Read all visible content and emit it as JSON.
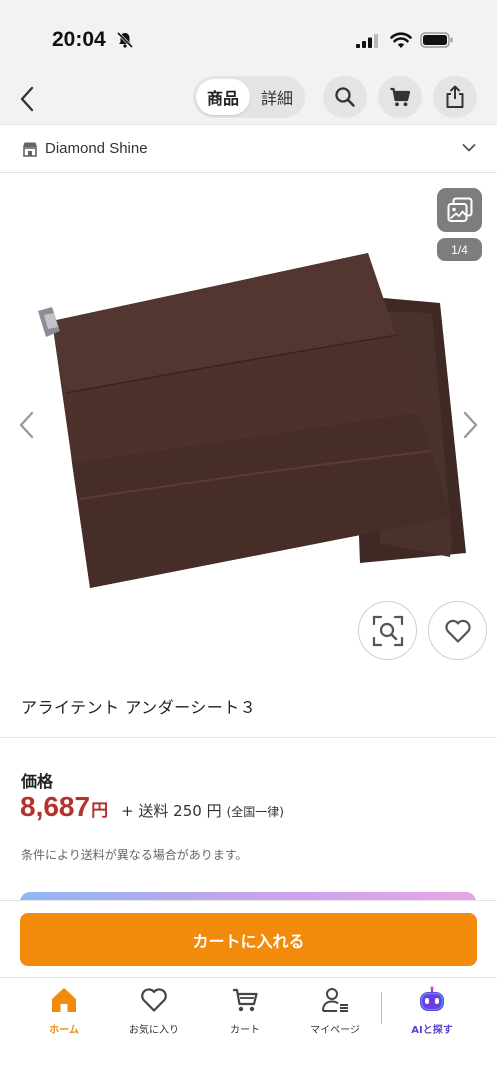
{
  "status_bar": {
    "time": "20:04"
  },
  "header": {
    "tabs": [
      {
        "label": "商品"
      },
      {
        "label": "詳細"
      }
    ],
    "icons": [
      "search-icon",
      "cart-icon",
      "share-icon"
    ]
  },
  "shop": {
    "name": "Diamond Shine"
  },
  "gallery": {
    "counter": "1/4"
  },
  "product": {
    "title": "アライテント アンダーシート３"
  },
  "price": {
    "label": "価格",
    "amount": "8,687",
    "currency": "円",
    "shipping": "+ 送料 250 円",
    "shipping_area": "(全国一律)",
    "note": "条件により送料が異なる場合があります。"
  },
  "actions": {
    "add_to_cart": "カートに入れる"
  },
  "tab_bar": {
    "items": [
      {
        "label": "ホーム",
        "icon": "home-icon"
      },
      {
        "label": "お気に入り",
        "icon": "heart-icon"
      },
      {
        "label": "カート",
        "icon": "cart-icon"
      },
      {
        "label": "マイページ",
        "icon": "user-icon"
      },
      {
        "label": "AIと探す",
        "icon": "ai-robot-icon"
      }
    ]
  },
  "colors": {
    "accent": "#f28a0c",
    "price": "#b5312b",
    "home_active": "#f28a0c",
    "ai_label": "#5b3fd6"
  }
}
